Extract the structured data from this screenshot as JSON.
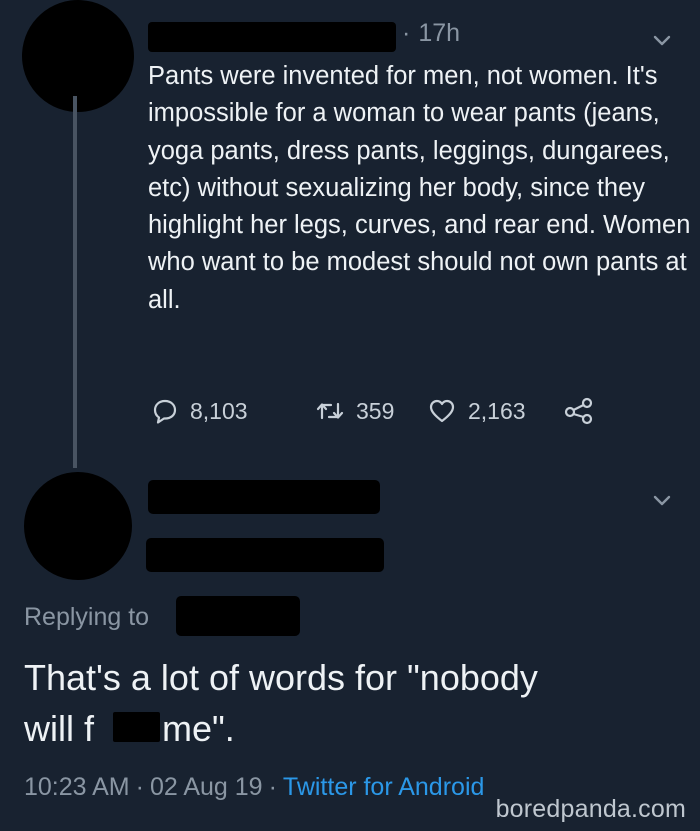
{
  "tweet": {
    "time": "17h",
    "text": "Pants were invented for men, not women. It's impossible for a woman to wear pants (jeans, yoga pants, dress pants, leggings, dungarees, etc) without sexualizing her body, since they highlight her legs, curves, and rear end. Women who want to be modest should not own pants at all.",
    "reply_count": "8,103",
    "retweet_count": "359",
    "like_count": "2,163"
  },
  "reply": {
    "replying_to_label": "Replying to",
    "text_line1": "That's a lot of words for \"nobody",
    "text_line2_before": "will f",
    "text_line2_after": "k me\".",
    "time": "10:23 AM",
    "date": "02 Aug 19",
    "source": "Twitter for Android",
    "separator": "·"
  },
  "watermark": "boredpanda.com",
  "colors": {
    "background": "#182230",
    "text": "#eef2f5",
    "muted": "#8a96a3",
    "link": "#2b98e8"
  },
  "icons": [
    "chevron-down-icon",
    "reply-icon",
    "retweet-icon",
    "like-icon",
    "share-icon"
  ]
}
